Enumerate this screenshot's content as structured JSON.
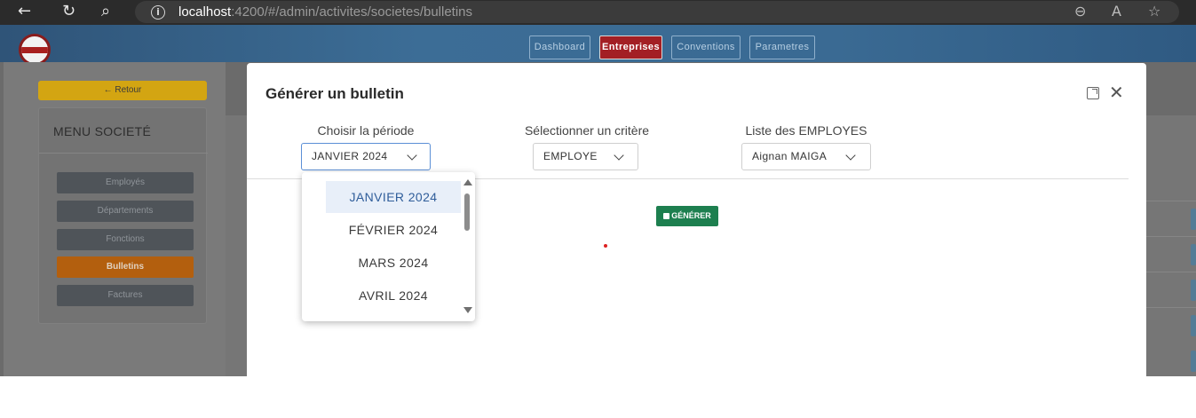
{
  "browser": {
    "back_glyph": "←",
    "reload_glyph": "↻",
    "search_glyph": "⌕",
    "info_glyph": "i",
    "url_host": "localhost",
    "url_rest": ":4200/#/admin/activites/societes/bulletins",
    "zoom_glyph": "⊖",
    "read_glyph": "A",
    "fav_glyph": "☆"
  },
  "header": {
    "tabs": [
      {
        "label": "Dashboard"
      },
      {
        "label": "Entreprises"
      },
      {
        "label": "Conventions"
      },
      {
        "label": "Parametres"
      }
    ]
  },
  "sidebar": {
    "back_label": "← Retour",
    "menu_title": "MENU SOCIETÉ",
    "items": [
      {
        "label": "Employés"
      },
      {
        "label": "Départements"
      },
      {
        "label": "Fonctions"
      },
      {
        "label": "Bulletins"
      },
      {
        "label": "Factures"
      }
    ]
  },
  "modal": {
    "title": "Générer un bulletin",
    "close_glyph": "✕",
    "fields": [
      {
        "label": "Choisir la période",
        "value": "JANVIER 2024"
      },
      {
        "label": "Sélectionner un critère",
        "value": "EMPLOYE"
      },
      {
        "label": "Liste des EMPLOYES",
        "value": "Aignan MAIGA"
      }
    ],
    "generate_label": "GÉNÉRER",
    "period_options": [
      "JANVIER 2024",
      "FÉVRIER 2024",
      "MARS 2024",
      "AVRIL 2024"
    ]
  },
  "colors": {
    "header_blue": "#3a6a93",
    "active_tab": "#a31f24",
    "retour_yellow": "#d3a512",
    "active_menu": "#b35f0e",
    "generate_green": "#1d7f4f"
  }
}
